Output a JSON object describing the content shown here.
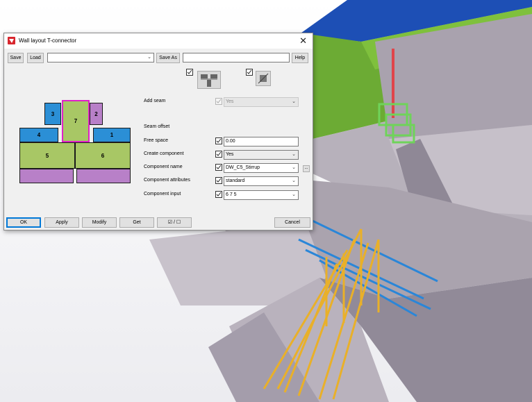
{
  "window": {
    "title": "Wall layout T-connector",
    "close_glyph": "✕"
  },
  "toolbar": {
    "save_label": "Save",
    "load_label": "Load",
    "preset_value": "",
    "save_as_label": "Save As",
    "save_as_value": "",
    "help_label": "Help"
  },
  "diagram": {
    "parts": [
      {
        "label": "1",
        "color": "blue"
      },
      {
        "label": "2",
        "color": "purple"
      },
      {
        "label": "3",
        "color": "blue"
      },
      {
        "label": "4",
        "color": "blue"
      },
      {
        "label": "5",
        "color": "green"
      },
      {
        "label": "6",
        "color": "green"
      },
      {
        "label": "7",
        "color": "green",
        "selected": true
      }
    ]
  },
  "form": {
    "add_seam_label": "Add seam",
    "add_seam_value": "Yes",
    "seam_offset_label": "Seam offset",
    "free_space_label": "Free space",
    "free_space_value": "0.00",
    "create_component_label": "Create component",
    "create_component_value": "Yes",
    "component_name_label": "Component name",
    "component_name_value": "DW_C5_Stirrup",
    "browse_label": "...",
    "component_attributes_label": "Component attributes",
    "component_attributes_value": "standard",
    "component_input_label": "Component input",
    "component_input_value": "6 7 5"
  },
  "footer": {
    "ok_label": "OK",
    "apply_label": "Apply",
    "modify_label": "Modify",
    "get_label": "Get",
    "toggle_label": "☑ / ☐",
    "cancel_label": "Cancel"
  },
  "colors": {
    "accent": "#0078d7",
    "wall_blue": "#2b8fd6",
    "wall_green": "#a8c765",
    "wall_purple": "#b880c8",
    "selected_outline": "#e020c8"
  }
}
